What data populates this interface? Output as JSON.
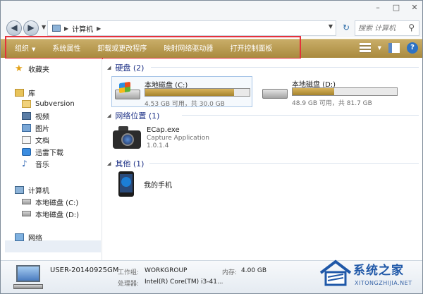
{
  "window": {
    "controls": [
      "–",
      "□",
      "✕"
    ],
    "address_path": [
      "计算机"
    ],
    "search_placeholder": "搜索 计算机"
  },
  "toolbar": {
    "items": [
      {
        "label": "组织",
        "has_dropdown": true
      },
      {
        "label": "系统属性"
      },
      {
        "label": "卸载或更改程序"
      },
      {
        "label": "映射网络驱动器"
      },
      {
        "label": "打开控制面板"
      }
    ],
    "help": "?"
  },
  "sidebar": {
    "favorites": "收藏夹",
    "library": "库",
    "library_items": [
      "Subversion",
      "视频",
      "图片",
      "文档",
      "迅雷下载",
      "音乐"
    ],
    "computer": "计算机",
    "drives": [
      "本地磁盘 (C:)",
      "本地磁盘 (D:)"
    ],
    "network": "网络"
  },
  "main": {
    "hard_disks_header": "硬盘 (2)",
    "drives": [
      {
        "name": "本地磁盘 (C:)",
        "info": "4.53 GB 可用，共 30.0 GB",
        "used_fraction": 0.85
      },
      {
        "name": "本地磁盘 (D:)",
        "info": "48.9 GB 可用，共 81.7 GB",
        "used_fraction": 0.4
      }
    ],
    "network_header": "网络位置 (1)",
    "network_item": {
      "title": "ECap.exe",
      "desc": "Capture Application",
      "version": "1.0.1.4"
    },
    "other_header": "其他 (1)",
    "other_item": "我的手机"
  },
  "details": {
    "name": "USER-20140925GM",
    "workgroup_label": "工作组:",
    "workgroup_value": "WORKGROUP",
    "memory_label": "内存:",
    "memory_value": "4.00 GB",
    "processor_label": "处理器:",
    "processor_value": "Intel(R) Core(TM) i3-41..."
  },
  "watermark": {
    "text": "系统之家",
    "url": "XITONGZHIJIA.NET"
  },
  "colors": {
    "toolbar": "#b4954a",
    "highlight": "#e4313b",
    "group_header": "#1e3287",
    "drive_fill": "#b8963e"
  }
}
